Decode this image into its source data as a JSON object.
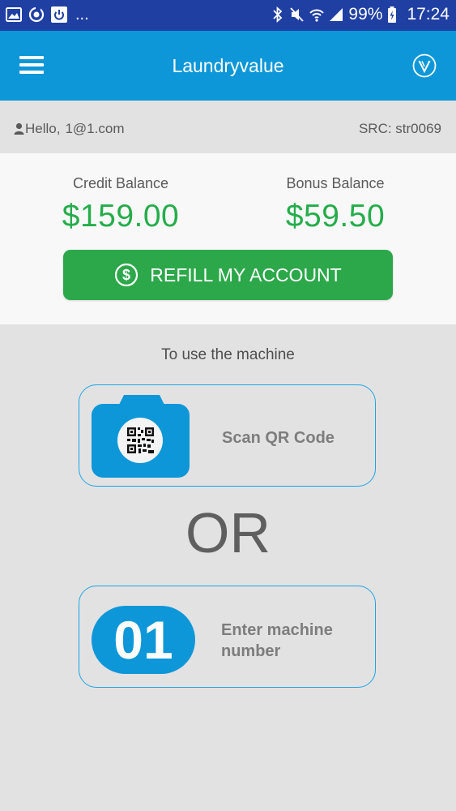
{
  "status_bar": {
    "left_icons": [
      "image-icon",
      "sync-icon",
      "power-icon"
    ],
    "more": "...",
    "battery": "99%",
    "time": "17:24"
  },
  "app_bar": {
    "title": "Laundryvalue"
  },
  "user": {
    "greeting": "Hello,",
    "email": "1@1.com",
    "src": "SRC: str0069"
  },
  "balance": {
    "credit_label": "Credit Balance",
    "credit_value": "$159.00",
    "bonus_label": "Bonus Balance",
    "bonus_value": "$59.50",
    "refill_label": "REFILL MY ACCOUNT"
  },
  "machine": {
    "use_label": "To use the machine",
    "scan_label": "Scan QR Code",
    "or_text": "OR",
    "number_badge": "01",
    "enter_label_line1": "Enter machine",
    "enter_label_line2": "number"
  },
  "colors": {
    "status_bar": "#1f3fa3",
    "app_bar": "#0d97d8",
    "money_green": "#25ad4a",
    "button_green": "#2ca84a",
    "card_border": "#1aa6e3"
  }
}
